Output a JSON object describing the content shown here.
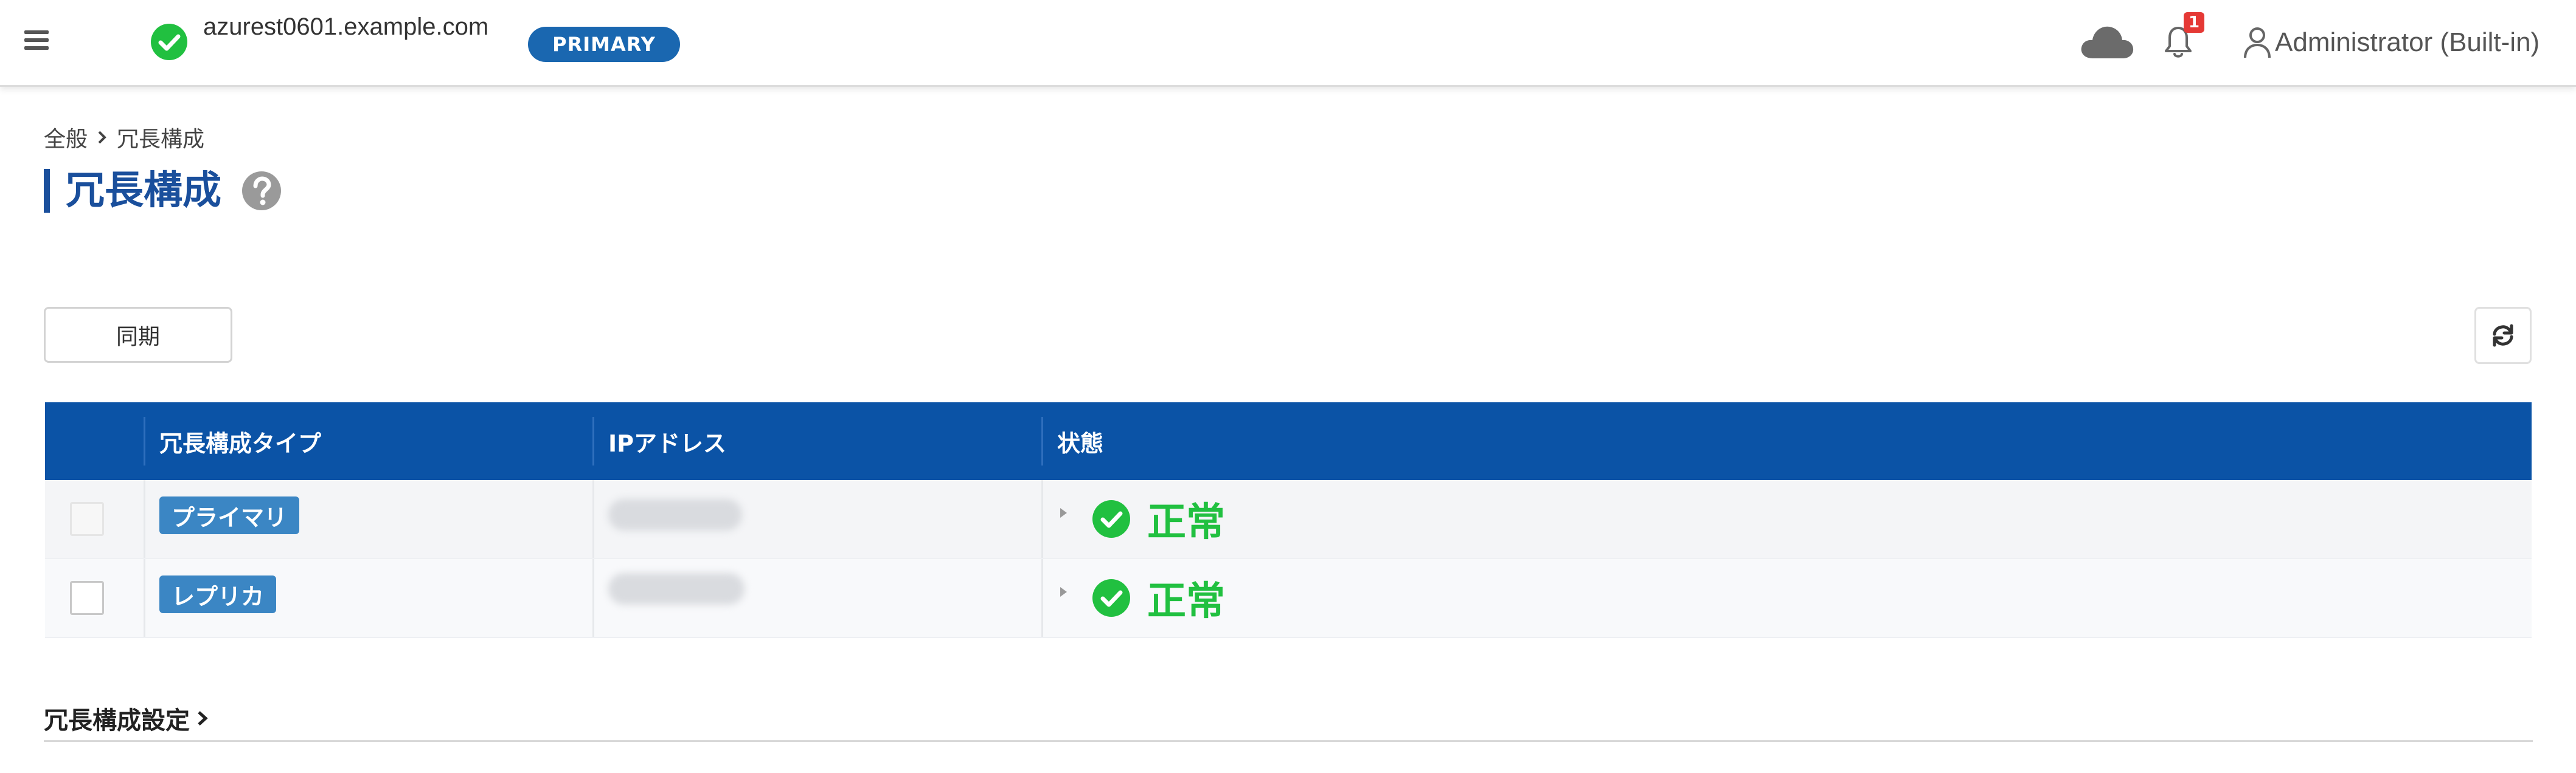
{
  "header": {
    "hostname": "azurest0601.example.com",
    "role_badge": "PRIMARY",
    "notification_count": "1",
    "user_name": "Administrator (Built-in)",
    "colors": {
      "accent": "#1a67b0",
      "status_ok": "#21c040",
      "alert": "#e53935"
    },
    "icons": [
      "menu-icon",
      "check-circle-icon",
      "cloud-icon",
      "bell-icon",
      "user-icon"
    ]
  },
  "breadcrumb": {
    "parent": "全般",
    "current": "冗長構成"
  },
  "page": {
    "title": "冗長構成"
  },
  "toolbar": {
    "sync_label": "同期"
  },
  "table": {
    "columns": [
      "冗長構成タイプ",
      "IPアドレス",
      "状態"
    ],
    "rows": [
      {
        "type": "プライマリ",
        "status": "正常",
        "checkbox_enabled": false
      },
      {
        "type": "レプリカ",
        "status": "正常",
        "checkbox_enabled": true
      }
    ]
  },
  "section": {
    "title": "冗長構成設定"
  }
}
